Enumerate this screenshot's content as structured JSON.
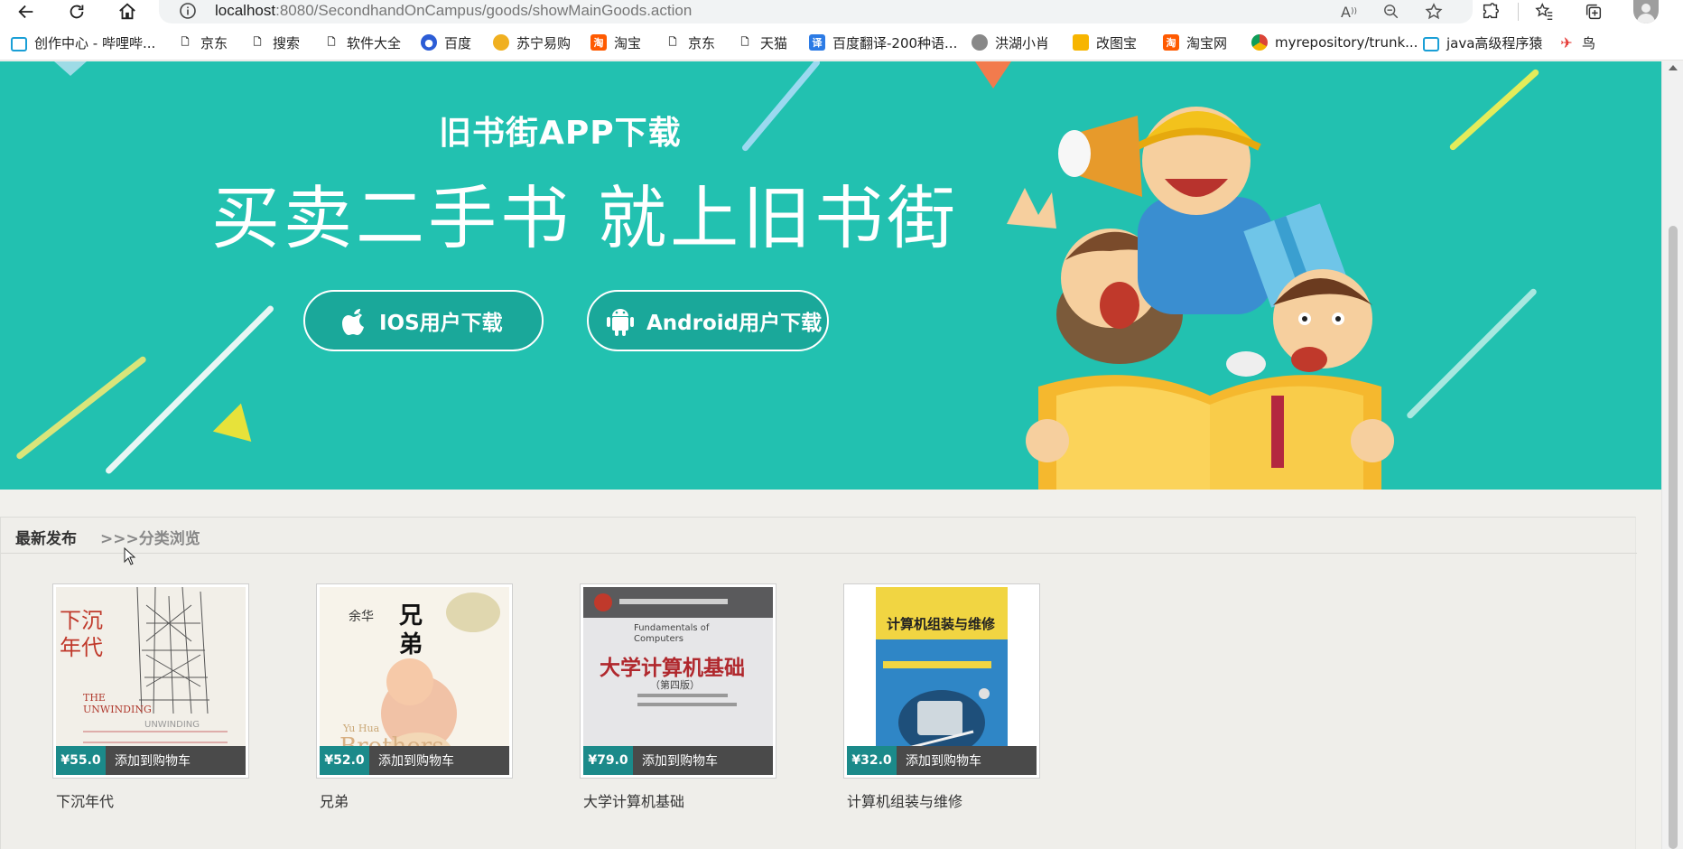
{
  "browser": {
    "url_host": "localhost",
    "url_path": ":8080/SecondhandOnCampus/goods/showMainGoods.action"
  },
  "bookmarks": [
    {
      "label": "创作中心 - 哔哩哔...",
      "icon": "bilibili-icon"
    },
    {
      "label": "京东",
      "icon": "page-icon"
    },
    {
      "label": "搜索",
      "icon": "page-icon"
    },
    {
      "label": "软件大全",
      "icon": "page-icon"
    },
    {
      "label": "百度",
      "icon": "baidu-paw-icon"
    },
    {
      "label": "苏宁易购",
      "icon": "suning-icon"
    },
    {
      "label": "淘宝",
      "icon": "taobao-icon"
    },
    {
      "label": "京东",
      "icon": "page-icon"
    },
    {
      "label": "天猫",
      "icon": "page-icon"
    },
    {
      "label": "百度翻译-200种语...",
      "icon": "baidu-translate-icon"
    },
    {
      "label": "洪湖小肖",
      "icon": "site-icon"
    },
    {
      "label": "改图宝",
      "icon": "gaitubao-icon"
    },
    {
      "label": "淘宝网",
      "icon": "taobao-icon"
    },
    {
      "label": "myrepository/trunk...",
      "icon": "chrome-icon"
    },
    {
      "label": "java高级程序猿",
      "icon": "bilibili-icon"
    },
    {
      "label": "鸟",
      "icon": "bird-icon"
    }
  ],
  "banner": {
    "subtitle": "旧书街APP下载",
    "title": "买卖二手书 就上旧书街",
    "ios_button": "IOS用户下载",
    "android_button": "Android用户下载",
    "bg_color": "#22c1b0"
  },
  "section": {
    "latest_tab": "最新发布",
    "category_link": ">>>分类浏览"
  },
  "products": [
    {
      "title": "下沉年代",
      "price": "¥55.0",
      "cart_label": "添加到购物车"
    },
    {
      "title": "兄弟",
      "price": "¥52.0",
      "cart_label": "添加到购物车"
    },
    {
      "title": "大学计算机基础",
      "price": "¥79.0",
      "cart_label": "添加到购物车"
    },
    {
      "title": "计算机组装与维修",
      "price": "¥32.0",
      "cart_label": "添加到购物车"
    }
  ],
  "covers": {
    "c1_title": "下沉年代",
    "c1_en": "THE UNWINDING",
    "c2_author": "余华",
    "c2_title": "兄弟",
    "c2_en_author": "Yu Hua",
    "c2_en_title": "Brothers",
    "c3_en": "Fundamentals of Computers",
    "c3_title": "大学计算机基础",
    "c3_edition": "（第四版）",
    "c4_title": "计算机组装与维修"
  }
}
